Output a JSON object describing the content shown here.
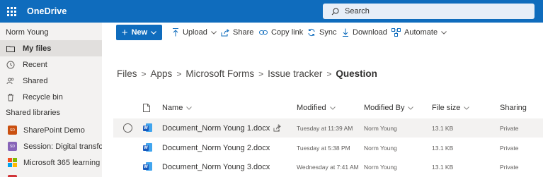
{
  "app": {
    "name": "OneDrive"
  },
  "search": {
    "label": "Search"
  },
  "sidebar": {
    "user": "Norm Young",
    "items": [
      {
        "label": "My files",
        "icon": "folder-icon",
        "selected": true
      },
      {
        "label": "Recent",
        "icon": "clock-icon",
        "selected": false
      },
      {
        "label": "Shared",
        "icon": "people-icon",
        "selected": false
      },
      {
        "label": "Recycle bin",
        "icon": "trash-icon",
        "selected": false
      }
    ],
    "libraries_label": "Shared libraries",
    "libraries": [
      {
        "label": "SharePoint Demo",
        "badge": "SD",
        "color": "#ca5010"
      },
      {
        "label": "Session: Digital transfor...",
        "badge": "SD",
        "color": "#8764b8"
      },
      {
        "label": "Microsoft 365 learning p...",
        "badge": "",
        "color": "multi"
      }
    ]
  },
  "commands": {
    "new": "New",
    "upload": "Upload",
    "share": "Share",
    "copy_link": "Copy link",
    "sync": "Sync",
    "download": "Download",
    "automate": "Automate"
  },
  "breadcrumb": {
    "items": [
      "Files",
      "Apps",
      "Microsoft Forms",
      "Issue tracker"
    ],
    "current": "Question"
  },
  "table": {
    "columns": {
      "name": "Name",
      "modified": "Modified",
      "modified_by": "Modified By",
      "file_size": "File size",
      "sharing": "Sharing"
    },
    "rows": [
      {
        "name": "Document_Norm Young 1.docx",
        "modified": "Tuesday at 11:39 AM",
        "modified_by": "Norm Young",
        "size": "13.1 KB",
        "sharing": "Private"
      },
      {
        "name": "Document_Norm Young 2.docx",
        "modified": "Tuesday at 5:38 PM",
        "modified_by": "Norm Young",
        "size": "13.1 KB",
        "sharing": "Private"
      },
      {
        "name": "Document_Norm Young 3.docx",
        "modified": "Wednesday at 7:41 AM",
        "modified_by": "Norm Young",
        "size": "13.1 KB",
        "sharing": "Private"
      }
    ]
  },
  "colors": {
    "brand": "#0f6cbd",
    "sidebar_bg": "#f3f2f1",
    "selected_bg": "#e1dfdd"
  }
}
